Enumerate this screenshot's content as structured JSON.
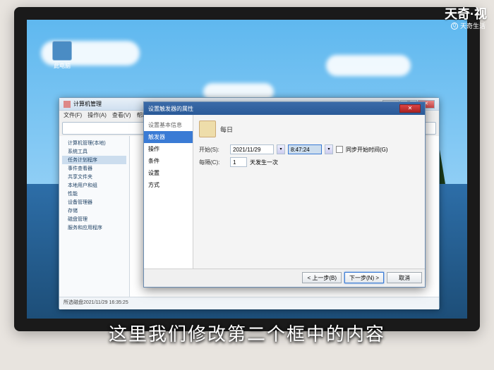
{
  "watermark": {
    "main": "天奇·视",
    "sub": "天奇生活"
  },
  "subtitle": "这里我们修改第二个框中的内容",
  "desktop_icon": "此电脑",
  "explorer": {
    "title": "计算机管理",
    "menu": [
      "文件(F)",
      "操作(A)",
      "查看(V)",
      "帮助(H)"
    ],
    "tree": [
      "计算机管理(本地)",
      "系统工具",
      "任务计划程序",
      "事件查看器",
      "共享文件夹",
      "本地用户和组",
      "性能",
      "设备管理器",
      "存储",
      "磁盘管理",
      "服务和应用程序"
    ],
    "status": "所选磁盘2021/11/29 16:35:25"
  },
  "dialog": {
    "title": "设置触发器的属性",
    "main_label": "每日",
    "cat_header": "设置基本信息",
    "cat_items": [
      "触发器",
      "操作",
      "条件",
      "设置",
      "方式"
    ],
    "row1": {
      "label": "开始(S):",
      "date": "2021/11/29",
      "time": "8:47:24",
      "checkbox": "同步开始时间(G)"
    },
    "row2": {
      "label": "每隔(C):",
      "value": "1",
      "unit": "天发生一次"
    },
    "buttons": {
      "prev": "< 上一步(B)",
      "next": "下一步(N) >",
      "cancel": "取消"
    }
  }
}
